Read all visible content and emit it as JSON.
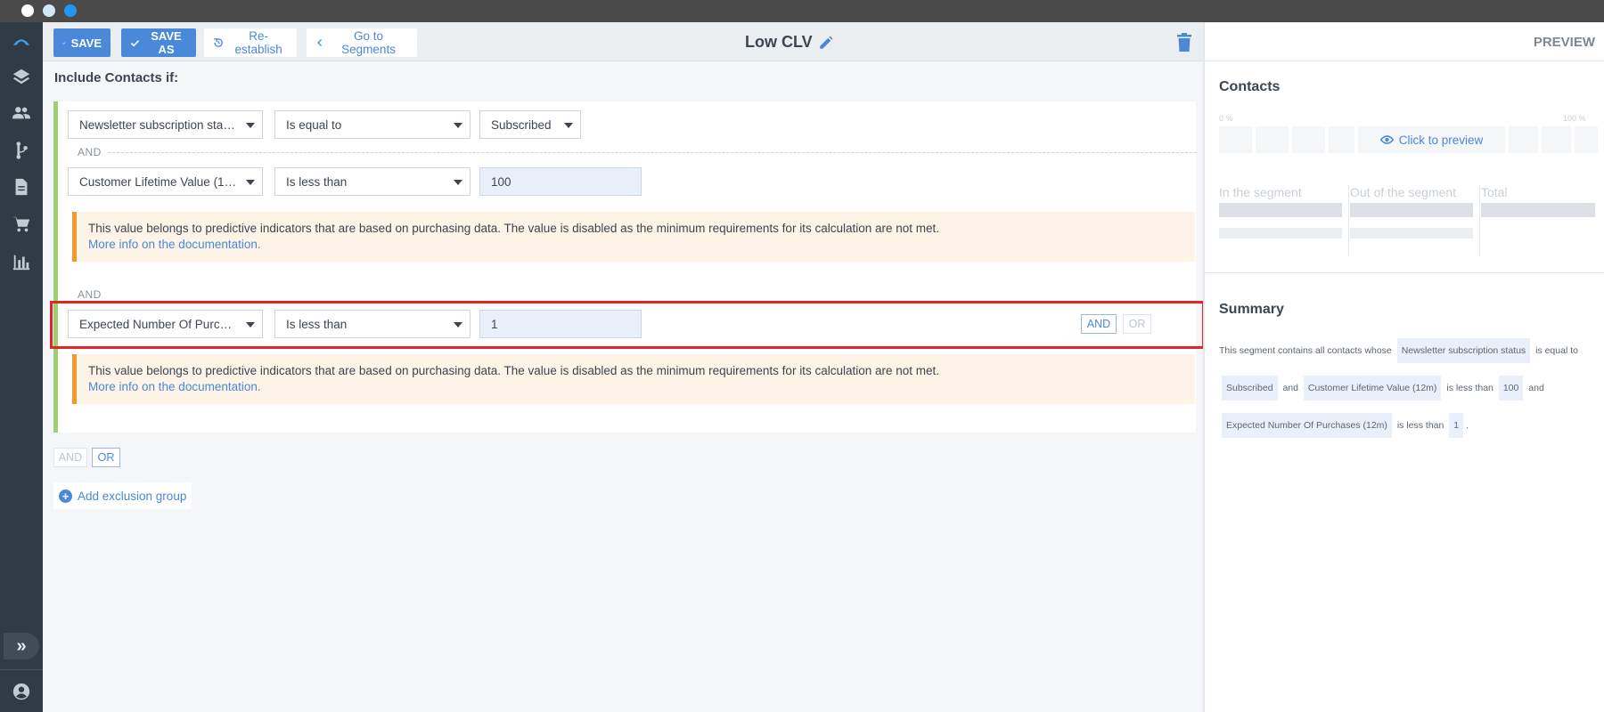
{
  "window": {
    "controls": [
      "close",
      "minimize",
      "maximize"
    ]
  },
  "rail": {
    "icons": [
      "logo-icon",
      "layers-icon",
      "contacts-icon",
      "workflow-icon",
      "document-icon",
      "cart-icon",
      "reports-icon"
    ],
    "expand_glyph": "»",
    "bottom_icon": "user-icon"
  },
  "toolbar": {
    "save_label": "SAVE",
    "save_as_label": "SAVE AS",
    "reestablish_label": "Re-establish",
    "go_segments_label": "Go to Segments",
    "segment_title": "Low CLV"
  },
  "editor": {
    "include_label": "Include Contacts if:",
    "conditions": [
      {
        "field": "Newsletter subscription status",
        "operator": "Is equal to",
        "value": "Subscribed",
        "value_type": "select"
      },
      {
        "field": "Customer Lifetime Value (12m)",
        "operator": "Is less than",
        "value": "100",
        "value_type": "input"
      },
      {
        "field": "Expected Number Of Purchases (12m)",
        "operator": "Is less than",
        "value": "1",
        "value_type": "input"
      }
    ],
    "connector_label": "AND",
    "warning_text": "This value belongs to predictive indicators that are based on purchasing data. The value is disabled as the minimum requirements for its calculation are not met.",
    "warning_link": "More info on the documentation.",
    "row_and": "AND",
    "row_or": "OR",
    "group_and": "AND",
    "group_or": "OR",
    "add_exclusion_label": "Add exclusion group"
  },
  "preview": {
    "header": "PREVIEW",
    "contacts_title": "Contacts",
    "pct_min": "0 %",
    "pct_max": "100 %",
    "click_to_preview": "Click to preview",
    "stats": [
      "In the segment",
      "Out of the segment",
      "Total"
    ],
    "summary_title": "Summary",
    "summary": {
      "intro": "This segment contains all contacts whose",
      "c1_field": "Newsletter subscription status",
      "c1_op": "is equal to",
      "c1_value": "Subscribed",
      "and1": "and",
      "c2_field": "Customer Lifetime Value (12m)",
      "c2_op": "is less than",
      "c2_value": "100",
      "and2": "and",
      "c3_field": "Expected Number Of Purchases (12m)",
      "c3_op": "is less than",
      "c3_value": "1",
      "end": "."
    }
  },
  "colors": {
    "accent": "#4a88da",
    "rail": "#2f3b45",
    "group_border": "#9ccf6e",
    "warning_border": "#f09a2b",
    "highlight": "#e3242b"
  }
}
